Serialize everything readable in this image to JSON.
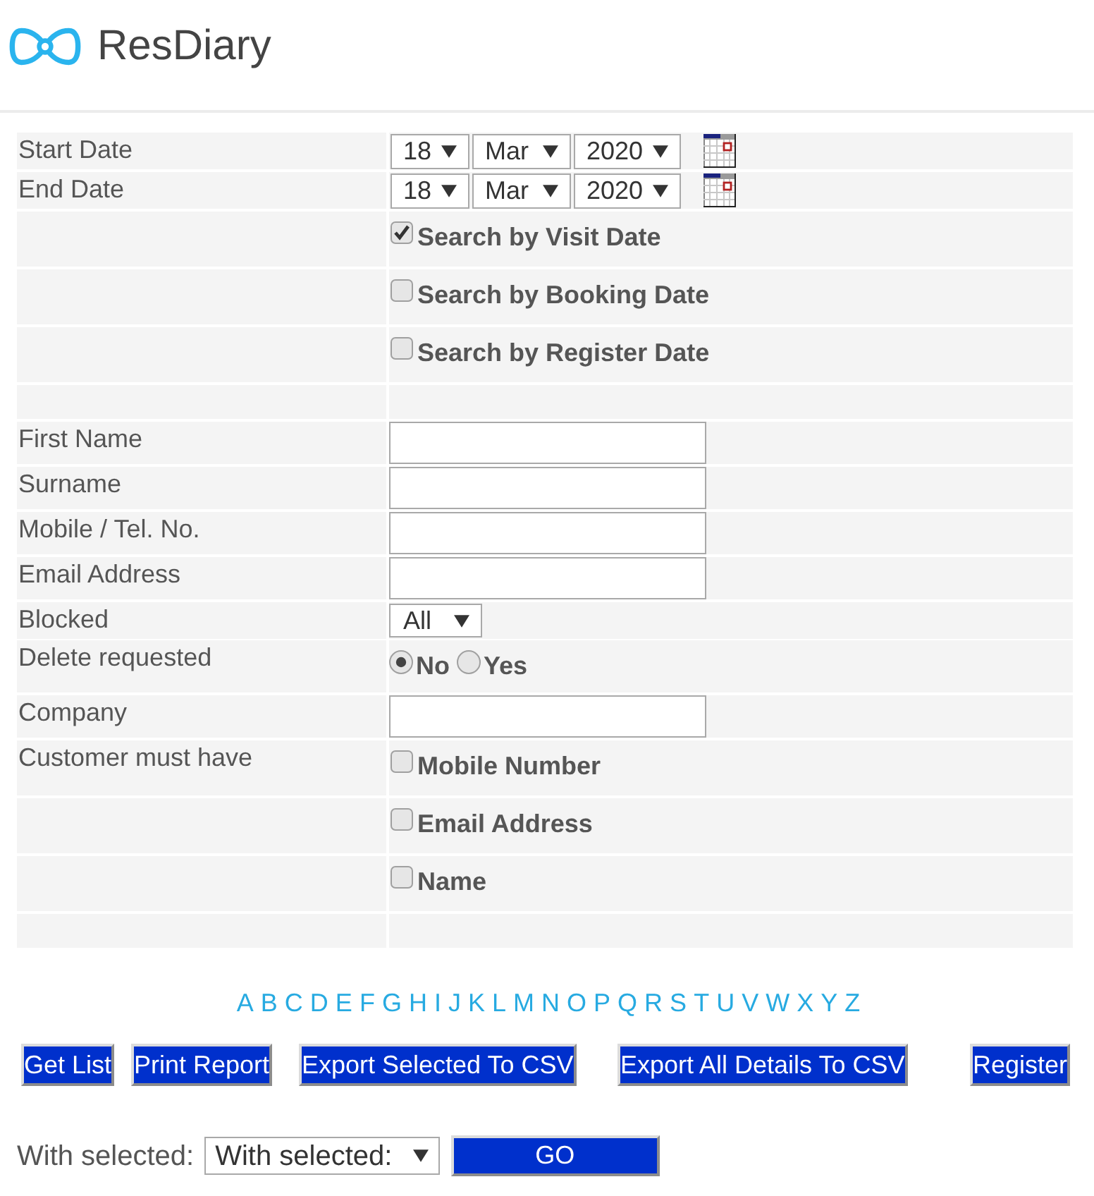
{
  "header": {
    "logo_text": "ResDiary"
  },
  "search_form": {
    "rows": [
      {
        "kind": "date",
        "label": "Start Date",
        "day": "18",
        "month": "Mar",
        "year": "2020"
      },
      {
        "kind": "date",
        "label": "End Date",
        "day": "18",
        "month": "Mar",
        "year": "2020"
      },
      {
        "kind": "checkbox",
        "text": "Search by Visit Date",
        "checked": true
      },
      {
        "kind": "checkbox",
        "text": "Search by Booking Date",
        "checked": false
      },
      {
        "kind": "checkbox",
        "text": "Search by Register Date",
        "checked": false
      },
      {
        "kind": "spacer"
      },
      {
        "kind": "text",
        "label": "First Name"
      },
      {
        "kind": "text",
        "label": "Surname"
      },
      {
        "kind": "text",
        "label": "Mobile / Tel. No."
      },
      {
        "kind": "text",
        "label": "Email Address"
      },
      {
        "kind": "select",
        "label": "Blocked",
        "value": "All"
      },
      {
        "kind": "radio",
        "label": "Delete requested",
        "options": [
          {
            "text": "No",
            "selected": true
          },
          {
            "text": "Yes",
            "selected": false
          }
        ]
      },
      {
        "kind": "text",
        "label": "Company"
      },
      {
        "kind": "checkbox",
        "label": "Customer must have",
        "text": "Mobile Number",
        "checked": false
      },
      {
        "kind": "checkbox",
        "text": "Email Address",
        "checked": false
      },
      {
        "kind": "checkbox",
        "text": "Name",
        "checked": false
      },
      {
        "kind": "spacer"
      }
    ]
  },
  "alphabet_links": [
    "A",
    "B",
    "C",
    "D",
    "E",
    "F",
    "G",
    "H",
    "I",
    "J",
    "K",
    "L",
    "M",
    "N",
    "O",
    "P",
    "Q",
    "R",
    "S",
    "T",
    "U",
    "V",
    "W",
    "X",
    "Y",
    "Z"
  ],
  "action_buttons": [
    "Get List",
    "Print Report",
    "Export Selected To CSV",
    "Export All Details To CSV",
    "Register"
  ],
  "bulk_action": {
    "label": "With selected:",
    "select_value": "With selected:",
    "button": "GO"
  }
}
